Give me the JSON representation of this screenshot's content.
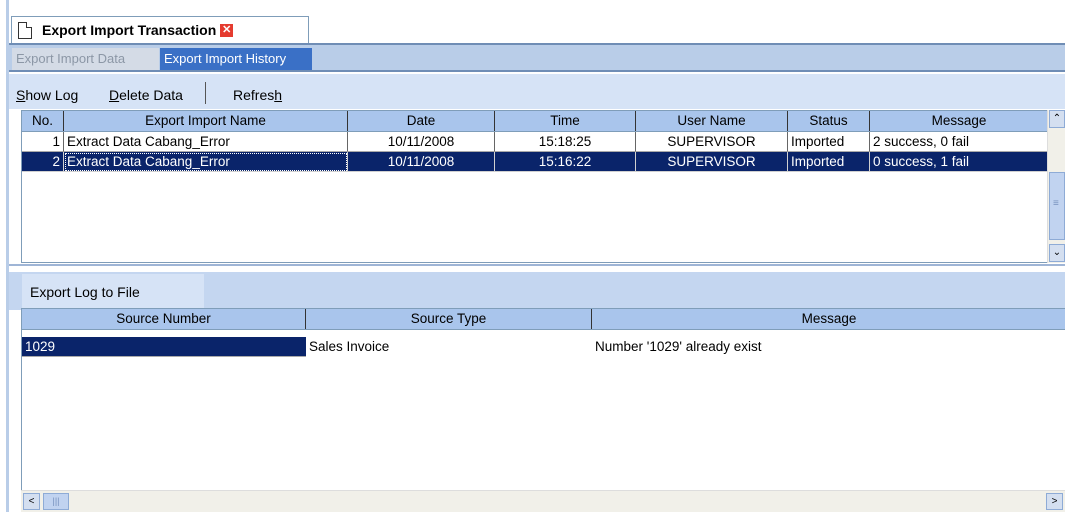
{
  "window": {
    "title": "Export Import Transaction",
    "close_glyph": "✕"
  },
  "tabs": [
    {
      "label": "Export Import Data",
      "active": false
    },
    {
      "label": "Export Import History",
      "active": true
    }
  ],
  "toolbar": {
    "show_log": {
      "before": "",
      "underline": "S",
      "after": "how Log"
    },
    "delete_data": {
      "before": "",
      "underline": "D",
      "after": "elete Data"
    },
    "refresh": {
      "before": "Refres",
      "underline": "h",
      "after": ""
    }
  },
  "history_table": {
    "columns": [
      "No.",
      "Export Import Name",
      "Date",
      "Time",
      "User Name",
      "Status",
      "Message"
    ],
    "rows": [
      {
        "no": "1",
        "name": "Extract Data Cabang_Error",
        "date": "10/11/2008",
        "time": "15:18:25",
        "user": "SUPERVISOR",
        "status": "Imported",
        "message": "2 success, 0 fail",
        "selected": false
      },
      {
        "no": "2",
        "name": "Extract Data Cabang_Error",
        "date": "10/11/2008",
        "time": "15:16:22",
        "user": "SUPERVISOR",
        "status": "Imported",
        "message": "0 success, 1 fail",
        "selected": true
      }
    ]
  },
  "log": {
    "export_button": "Export Log to File",
    "columns": [
      "Source Number",
      "Source Type",
      "Message"
    ],
    "rows": [
      {
        "source_number": "1029",
        "source_type": "Sales Invoice",
        "message": "Number '1029' already exist",
        "selected": true
      }
    ]
  },
  "icons": {
    "scroll_up": "⌃",
    "scroll_down": "⌄",
    "scroll_left": "<",
    "scroll_right": ">",
    "hthumb": "|||"
  },
  "colors": {
    "selection": "#0a246a",
    "header": "#a9c5ec",
    "active_tab": "#3a70c6",
    "close": "#e53b2f"
  }
}
